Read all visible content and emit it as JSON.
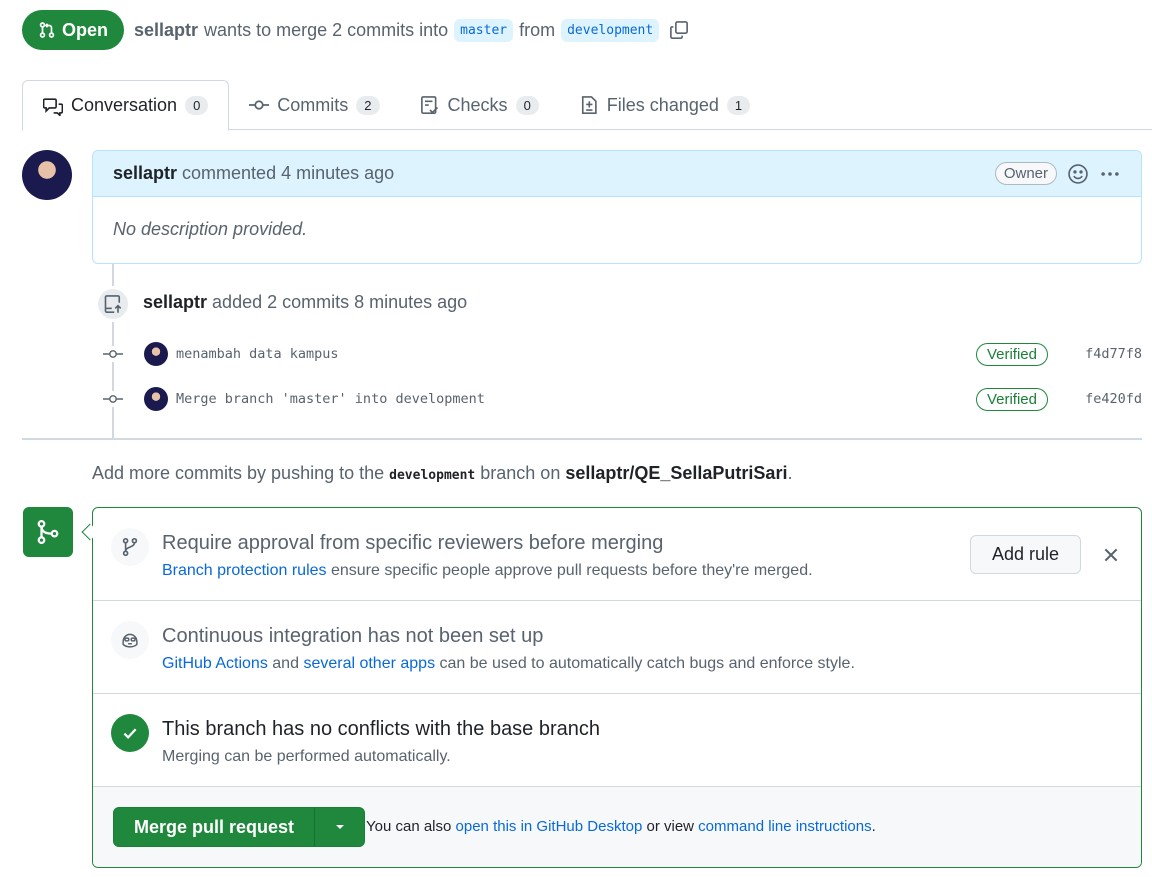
{
  "header": {
    "state": "Open",
    "author": "sellaptr",
    "text_wants": "wants to merge 2 commits into",
    "base_branch": "master",
    "text_from": "from",
    "head_branch": "development"
  },
  "tabs": [
    {
      "label": "Conversation",
      "count": "0",
      "icon": "comment-discussion-icon"
    },
    {
      "label": "Commits",
      "count": "2",
      "icon": "git-commit-icon"
    },
    {
      "label": "Checks",
      "count": "0",
      "icon": "checklist-icon"
    },
    {
      "label": "Files changed",
      "count": "1",
      "icon": "file-diff-icon"
    }
  ],
  "comment": {
    "author": "sellaptr",
    "action": "commented 4 minutes ago",
    "badge": "Owner",
    "body": "No description provided."
  },
  "event": {
    "author": "sellaptr",
    "action": "added 2 commits 8 minutes ago"
  },
  "commits": [
    {
      "message": "menambah data kampus",
      "status": "Verified",
      "sha": "f4d77f8"
    },
    {
      "message": "Merge branch 'master' into development",
      "status": "Verified",
      "sha": "fe420fd"
    }
  ],
  "push_hint": {
    "prefix": "Add more commits by pushing to the",
    "branch": "development",
    "middle": "branch on",
    "repo": "sellaptr/QE_SellaPutriSari",
    "suffix": "."
  },
  "merge_box": {
    "rules": {
      "title": "Require approval from specific reviewers before merging",
      "link": "Branch protection rules",
      "rest": "ensure specific people approve pull requests before they're merged.",
      "button": "Add rule"
    },
    "ci": {
      "title": "Continuous integration has not been set up",
      "link1": "GitHub Actions",
      "and": "and",
      "link2": "several other apps",
      "rest": "can be used to automatically catch bugs and enforce style."
    },
    "conflicts": {
      "title": "This branch has no conflicts with the base branch",
      "sub": "Merging can be performed automatically."
    },
    "footer": {
      "merge_button": "Merge pull request",
      "prefix": "You can also",
      "link1": "open this in GitHub Desktop",
      "middle": "or view",
      "link2": "command line instructions",
      "suffix": "."
    }
  },
  "colors": {
    "accent_green": "#1f883d",
    "link_blue": "#0969da",
    "comment_header_bg": "#ddf4ff"
  }
}
